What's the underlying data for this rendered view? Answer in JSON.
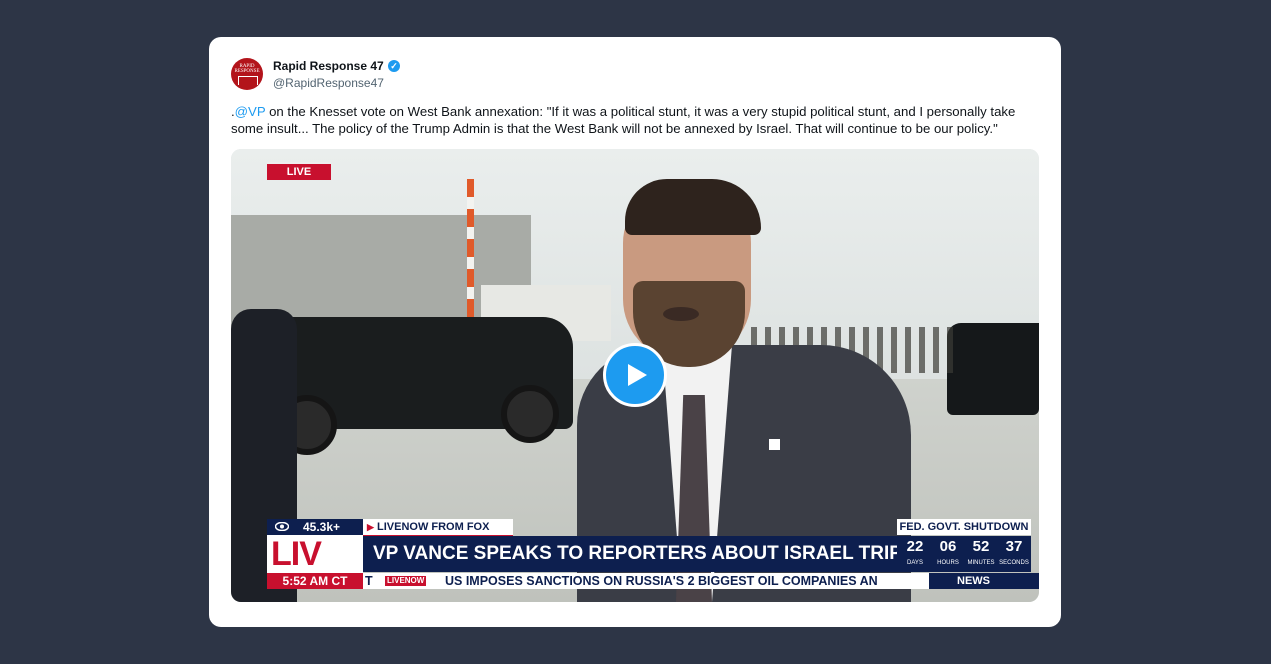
{
  "tweet": {
    "author_name": "Rapid Response 47",
    "handle": "@RapidResponse47",
    "avatar_seal_text": "RAPID RESPONSE",
    "text_prefix": ".",
    "mention": "@VP",
    "text_body": " on the Knesset vote on West Bank annexation: \"If it was a political stunt, it was a very stupid political stunt, and I personally take some insult... The policy of the Trump Admin is that the West Bank will not be annexed by Israel. That will continue to be our policy.\""
  },
  "video": {
    "live_tag": "LIVE",
    "play_icon": "play-icon",
    "lower_third": {
      "views": "45.3k+",
      "source": "LIVENOW FROM FOX",
      "logo_text": "LIV",
      "headline": "VP VANCE SPEAKS TO REPORTERS ABOUT ISRAEL TRIP",
      "time": "5:52 AM CT",
      "ticker_lead": "T",
      "ticker_badge": "LIVENOW",
      "ticker_text": "US IMPOSES SANCTIONS ON RUSSIA'S 2 BIGGEST OIL COMPANIES AN",
      "countdown_title": "FED. GOVT. SHUTDOWN",
      "countdown": [
        {
          "value": "22",
          "label": "DAYS"
        },
        {
          "value": "06",
          "label": "HOURS"
        },
        {
          "value": "52",
          "label": "MINUTES"
        },
        {
          "value": "37",
          "label": "SECONDS"
        }
      ],
      "news_label": "NEWS"
    }
  },
  "colors": {
    "background": "#2d3546",
    "link": "#1d9bf0",
    "fox_navy": "#0d1f4f",
    "fox_red": "#c8102e"
  }
}
